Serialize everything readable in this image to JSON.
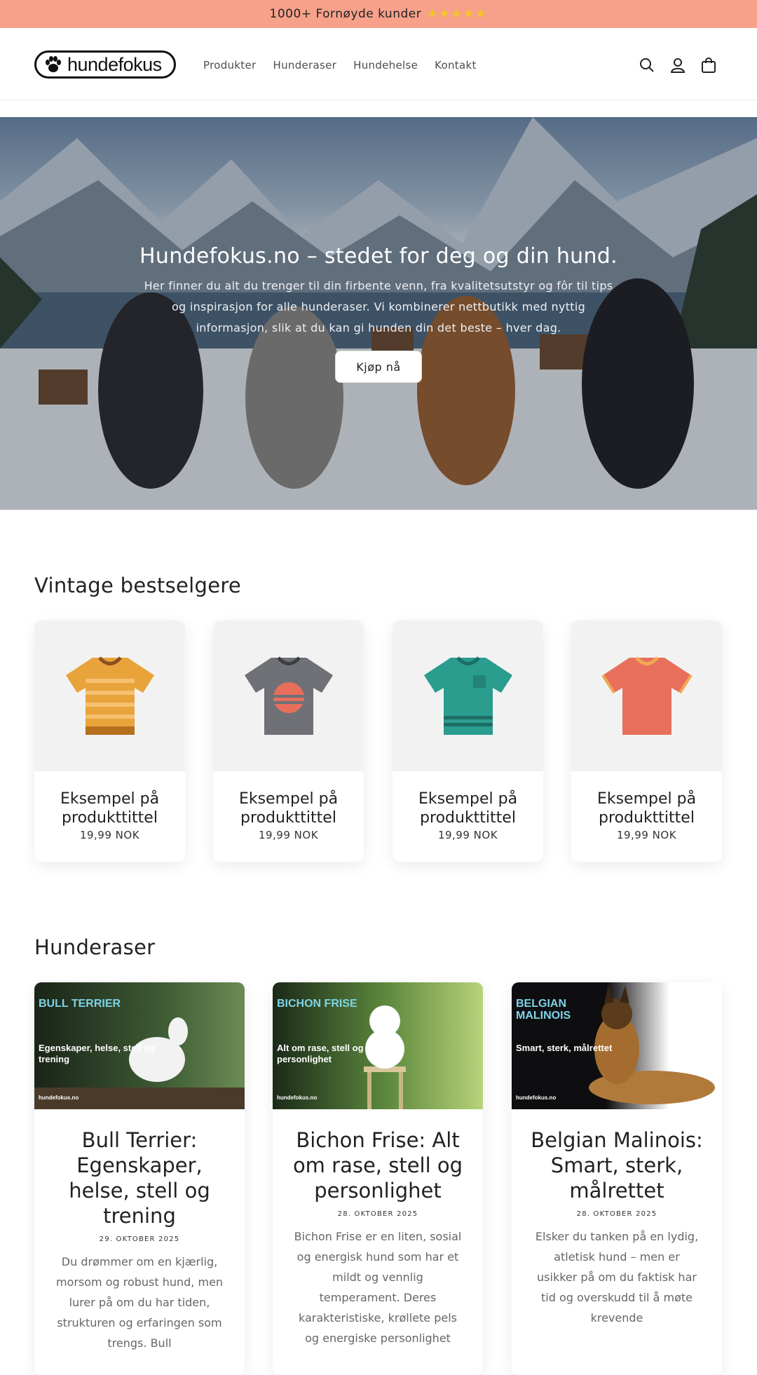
{
  "announcement": {
    "text": "1000+ Fornøyde kunder",
    "stars": "★★★★★"
  },
  "header": {
    "logo_text": "hundefokus",
    "nav": [
      "Produkter",
      "Hunderaser",
      "Hundehelse",
      "Kontakt"
    ],
    "icons": [
      "search-icon",
      "account-icon",
      "cart-icon"
    ]
  },
  "hero": {
    "title": "Hundefokus.no – stedet for deg og din hund.",
    "text": "Her finner du alt du trenger til din firbente venn, fra kvalitetsutstyr og fôr til tips og inspirasjon for alle hunderaser. Vi kombinerer nettbutikk med nyttig informasjon, slik at du kan gi hunden din det beste – hver dag.",
    "button": "Kjøp nå"
  },
  "bestsellers": {
    "title": "Vintage bestselgere",
    "products": [
      {
        "title": "Eksempel på produkttittel",
        "price": "19,99 NOK",
        "color": "#e8a33b"
      },
      {
        "title": "Eksempel på produkttittel",
        "price": "19,99 NOK",
        "color": "#6f7177"
      },
      {
        "title": "Eksempel på produkttittel",
        "price": "19,99 NOK",
        "color": "#2a9d8f"
      },
      {
        "title": "Eksempel på produkttittel",
        "price": "19,99 NOK",
        "color": "#e76f5c"
      }
    ]
  },
  "breeds": {
    "title": "Hunderaser",
    "posts": [
      {
        "tag": "BULL TERRIER",
        "subtitle": "Egenskaper, helse, stell og trening",
        "site": "hundefokus.no",
        "title": "Bull Terrier: Egenskaper, helse, stell og trening",
        "date": "29. OKTOBER 2025",
        "excerpt": "Du drømmer om en kjærlig, morsom og robust hund, men lurer på om du har tiden, strukturen og erfaringen som trengs. Bull"
      },
      {
        "tag": "BICHON FRISE",
        "subtitle": "Alt om rase, stell og personlighet",
        "site": "hundefokus.no",
        "title": "Bichon Frise: Alt om rase, stell og personlighet",
        "date": "28. OKTOBER 2025",
        "excerpt": "Bichon Frise er en liten, sosial og energisk hund som har et mildt og vennlig temperament.  Deres karakteristiske, krøllete pels og energiske personlighet"
      },
      {
        "tag": "BELGIAN MALINOIS",
        "subtitle": "Smart, sterk, målrettet",
        "site": "hundefokus.no",
        "title": "Belgian Malinois: Smart, sterk, målrettet",
        "date": "28. OKTOBER 2025",
        "excerpt": "Elsker du tanken på en lydig, atletisk hund – men er usikker på om du faktisk har tid og overskudd til å møte krevende"
      }
    ]
  },
  "colors": {
    "announcement_bg": "#f7a18b",
    "accent": "#7fd3e6"
  }
}
